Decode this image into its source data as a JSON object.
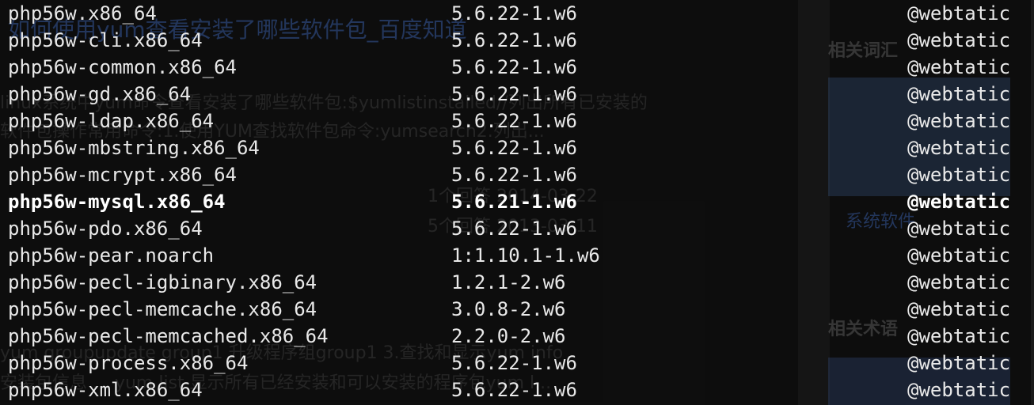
{
  "packages": [
    {
      "name": "php56w.x86_64",
      "version": "5.6.22-1.w6",
      "repo": "@webtatic",
      "bold": false
    },
    {
      "name": "php56w-cli.x86_64",
      "version": "5.6.22-1.w6",
      "repo": "@webtatic",
      "bold": false
    },
    {
      "name": "php56w-common.x86_64",
      "version": "5.6.22-1.w6",
      "repo": "@webtatic",
      "bold": false
    },
    {
      "name": "php56w-gd.x86_64",
      "version": "5.6.22-1.w6",
      "repo": "@webtatic",
      "bold": false
    },
    {
      "name": "php56w-ldap.x86_64",
      "version": "5.6.22-1.w6",
      "repo": "@webtatic",
      "bold": false
    },
    {
      "name": "php56w-mbstring.x86_64",
      "version": "5.6.22-1.w6",
      "repo": "@webtatic",
      "bold": false
    },
    {
      "name": "php56w-mcrypt.x86_64",
      "version": "5.6.22-1.w6",
      "repo": "@webtatic",
      "bold": false
    },
    {
      "name": "php56w-mysql.x86_64",
      "version": "5.6.21-1.w6",
      "repo": "@webtatic",
      "bold": true
    },
    {
      "name": "php56w-pdo.x86_64",
      "version": "5.6.22-1.w6",
      "repo": "@webtatic",
      "bold": false
    },
    {
      "name": "php56w-pear.noarch",
      "version": "1:1.10.1-1.w6",
      "repo": "@webtatic",
      "bold": false
    },
    {
      "name": "php56w-pecl-igbinary.x86_64",
      "version": "1.2.1-2.w6",
      "repo": "@webtatic",
      "bold": false
    },
    {
      "name": "php56w-pecl-memcache.x86_64",
      "version": "3.0.8-2.w6",
      "repo": "@webtatic",
      "bold": false
    },
    {
      "name": "php56w-pecl-memcached.x86_64",
      "version": "2.2.0-2.w6",
      "repo": "@webtatic",
      "bold": false
    },
    {
      "name": "php56w-process.x86_64",
      "version": "5.6.22-1.w6",
      "repo": "@webtatic",
      "bold": false
    },
    {
      "name": "php56w-xml.x86_64",
      "version": "5.6.22-1.w6",
      "repo": "@webtatic",
      "bold": false
    }
  ],
  "background_page": {
    "title": "如何使用yum查看安装了哪些软件包_百度知道",
    "sidebar_heading_1": "相关词汇",
    "sidebar_heading_2": "相关术语",
    "lines": [
      "linux系统中yum命令查看安装了哪些软件包:$yumlistinstalled//列出所有已安装的",
      "软件包操作常用命令:1.使用YUM查找软件包命令:yumsearch2.列出...",
      "1个回答 2014-03-22",
      "5个回答 2013-03-11",
      "系统软件",
      "yum groupupdate group1 升级程序组group1 3.查找和显示yum info",
      "安装包信息 ... yum list 显示所有已经安装和可以安装的程序包yum l..."
    ]
  },
  "colors": {
    "terminal_bg": "#0e0e0e",
    "text": "#e9e9e9"
  }
}
